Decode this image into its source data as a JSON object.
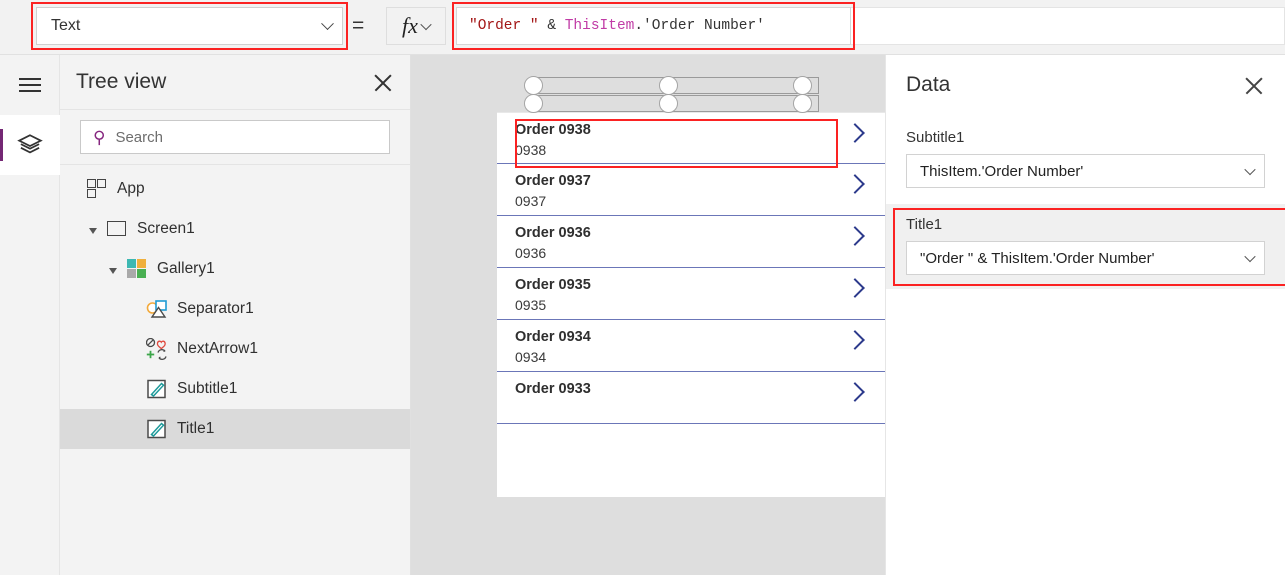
{
  "topbar": {
    "property_selector": {
      "value": "Text",
      "icon": "chevron-down-icon"
    },
    "equals_sign": "=",
    "fx_label": "fx",
    "formula": {
      "full": "\"Order \" & ThisItem.'Order Number'",
      "tokens": [
        {
          "text": "\"Order \"",
          "kind": "string"
        },
        {
          "text": " & ",
          "kind": "operator"
        },
        {
          "text": "ThisItem",
          "kind": "identifier"
        },
        {
          "text": ".'Order Number'",
          "kind": "operator"
        }
      ]
    }
  },
  "rail": {
    "items": [
      {
        "name": "hamburger-menu",
        "icon": "hamburger-icon",
        "active": false
      },
      {
        "name": "tree-view-toggle",
        "icon": "layers-icon",
        "active": true
      }
    ]
  },
  "tree_view": {
    "title": "Tree view",
    "close_icon": "close-icon",
    "search": {
      "placeholder": "Search",
      "value": "",
      "icon": "search-icon"
    },
    "items": [
      {
        "label": "App",
        "icon": "app-icon",
        "indent": 0,
        "caret": false,
        "selected": false
      },
      {
        "label": "Screen1",
        "icon": "screen-icon",
        "indent": 1,
        "caret": true,
        "selected": false
      },
      {
        "label": "Gallery1",
        "icon": "gallery-icon",
        "indent": 2,
        "caret": true,
        "selected": false
      },
      {
        "label": "Separator1",
        "icon": "separator-icon",
        "indent": 3,
        "caret": false,
        "selected": false
      },
      {
        "label": "NextArrow1",
        "icon": "nextarrow-icon",
        "indent": 3,
        "caret": false,
        "selected": false
      },
      {
        "label": "Subtitle1",
        "icon": "label-icon",
        "indent": 3,
        "caret": false,
        "selected": false
      },
      {
        "label": "Title1",
        "icon": "label-icon",
        "indent": 3,
        "caret": false,
        "selected": true
      }
    ]
  },
  "canvas": {
    "gallery": {
      "items": [
        {
          "title": "Order 0938",
          "subtitle": "0938",
          "chevron": "chevron-right-icon",
          "selected": true
        },
        {
          "title": "Order 0937",
          "subtitle": "0937",
          "chevron": "chevron-right-icon",
          "selected": false
        },
        {
          "title": "Order 0936",
          "subtitle": "0936",
          "chevron": "chevron-right-icon",
          "selected": false
        },
        {
          "title": "Order 0935",
          "subtitle": "0935",
          "chevron": "chevron-right-icon",
          "selected": false
        },
        {
          "title": "Order 0934",
          "subtitle": "0934",
          "chevron": "chevron-right-icon",
          "selected": false
        },
        {
          "title": "Order 0933",
          "subtitle": "",
          "chevron": "chevron-right-icon",
          "selected": false
        }
      ]
    }
  },
  "data_panel": {
    "title": "Data",
    "close_icon": "close-icon",
    "fields": [
      {
        "label": "Subtitle1",
        "value": "ThisItem.'Order Number'",
        "highlighted": false,
        "icon": "chevron-down-icon"
      },
      {
        "label": "Title1",
        "value": "\"Order \" & ThisItem.'Order Number'",
        "highlighted": true,
        "icon": "chevron-down-icon"
      }
    ]
  },
  "colors": {
    "highlight_outline": "#fb2222",
    "accent_purple": "#742774",
    "gallery_separator": "#6b76b8",
    "gallery_chevron": "#2c3a8c",
    "string_token": "#a31515",
    "identifier_token": "#c13ca6"
  }
}
